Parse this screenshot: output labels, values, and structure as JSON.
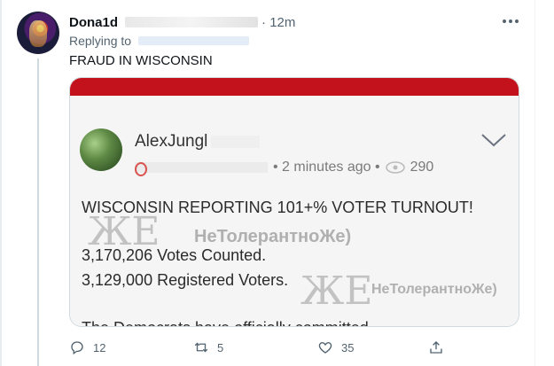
{
  "tweet": {
    "author": "Dona1d",
    "time": "12m",
    "replying_label": "Replying to",
    "text": "FRAUD IN WISCONSIN"
  },
  "embedded_post": {
    "name": "AlexJungl",
    "time": "2 minutes ago",
    "views": "290",
    "headline": "WISCONSIN REPORTING 101+% VOTER TURNOUT!",
    "line_votes": "3,170,206 Votes Counted.",
    "line_registered": "3,129,000 Registered Voters.",
    "line_democrats": "The Democrats have officially committed",
    "watermark_1": "НеТолерантноЖе)",
    "watermark_2": "НеТолерантноЖе)",
    "accent_color": "#c3121c"
  },
  "actions": {
    "replies": "12",
    "retweets": "5",
    "likes": "35"
  }
}
